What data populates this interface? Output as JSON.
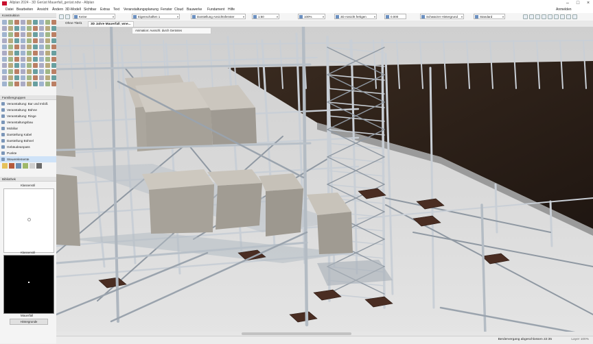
{
  "window": {
    "title": "Allplan 2024 - 3D Gerüst Mauerfall_gerüst.ndw - Allplan",
    "minimize": "–",
    "maximize": "□",
    "close": "×"
  },
  "menu": [
    "Datei",
    "Bearbeiten",
    "Ansicht",
    "Ändern",
    "3D-Modell",
    "Sichtbar",
    "Extras",
    "Text",
    "Veranstaltungsplanung",
    "Fenster",
    "Cloud",
    "Bauwerke",
    "Fundament",
    "Hilfe"
  ],
  "user": "Anmelden",
  "toolbar": {
    "selects": [
      "Keine",
      "Eigenschaften 1",
      "Darstellung Ansichtsfenster",
      "1:50",
      "100%",
      "3D Ansicht fertigen",
      "0.000",
      "Schwarzer Hintergrund",
      "Standard"
    ]
  },
  "tabs": [
    "Ohne Titel1",
    "3D Jahre Mauerfall_wne..."
  ],
  "view_status": "Animation: Ausschl. durch Gerüstes",
  "left_panel": {
    "header_top": "Konstruktion",
    "library_header": "Familiengruppen",
    "items": [
      "Veranstaltung: Bar und Imbiß",
      "Veranstaltung: Bühne",
      "Veranstaltung: Ringe",
      "Veranstaltungsbau",
      "Mobiliar",
      "Darstellung Kabel",
      "Darstellung Bühnel",
      "Gebäudeanpass",
      "Punkte",
      "Steuerelemente"
    ],
    "selected_index": 9,
    "preview_header": "Bibliothek",
    "preview_title": "Klassenstil",
    "black_header": "Klassenstil",
    "bottom_label": "Mauerfall",
    "bottom_button": "Hintergrunde"
  },
  "status": {
    "text": "Berdervergang abgeschlossen 22:35",
    "zoom": "Layer 100%"
  },
  "colors": {
    "scaffold": "#c9cfd6",
    "scaffold_dark": "#8f98a2",
    "roof": "#2c2018",
    "block": "#aca79f",
    "baseplate": "#4a2d22"
  }
}
